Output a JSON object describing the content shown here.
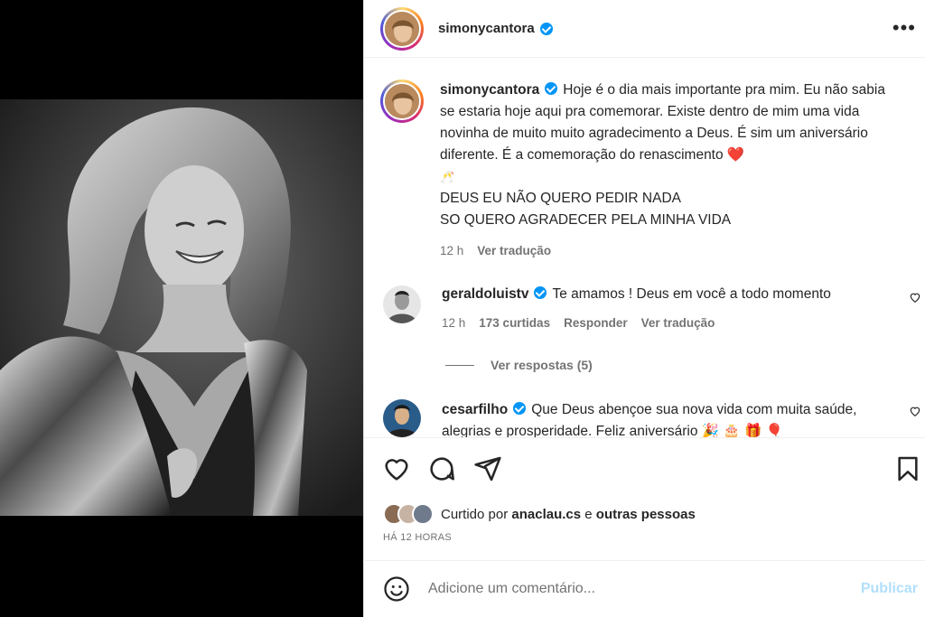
{
  "post": {
    "author": "simonycantora",
    "more_label": "•••"
  },
  "caption": {
    "user": "simonycantora",
    "text": "Hoje é o dia mais importante pra mim. Eu não sabia se estaria hoje aqui pra comemorar. Existe dentro de mim uma vida novinha de muito muito agradecimento a Deus. É sim um aniversário diferente. É a comemoração do renascimento ❤️",
    "emoji_line": "🥂",
    "line2": "DEUS EU NÃO QUERO PEDIR NADA",
    "line3": "SO QUERO AGRADECER PELA MINHA VIDA",
    "time": "12 h",
    "translate": "Ver tradução"
  },
  "comments": [
    {
      "user": "geraldoluistv",
      "text": "Te amamos ! Deus em você a todo momento",
      "time": "12 h",
      "likes": "173 curtidas",
      "reply": "Responder",
      "translate": "Ver tradução",
      "view_replies": "Ver respostas (5)"
    },
    {
      "user": "cesarfilho",
      "text": "Que Deus abençoe sua nova vida com muita saúde, alegrias e prosperidade. Feliz aniversário 🎉 🎂 🎁 🎈"
    }
  ],
  "likes": {
    "prefix": "Curtido por",
    "user": "anaclau.cs",
    "conjunction": "e",
    "others": "outras pessoas"
  },
  "timestamp": "HÁ 12 HORAS",
  "comment_box": {
    "placeholder": "Adicione um comentário...",
    "publish": "Publicar"
  },
  "icons": [
    "heart-icon",
    "comment-icon",
    "share-icon",
    "bookmark-icon",
    "emoji-icon",
    "more-icon",
    "verified-icon"
  ],
  "colors": {
    "verified": "#0095f6",
    "publish_disabled": "#b2dffc",
    "heart_red": "#ed4956"
  }
}
